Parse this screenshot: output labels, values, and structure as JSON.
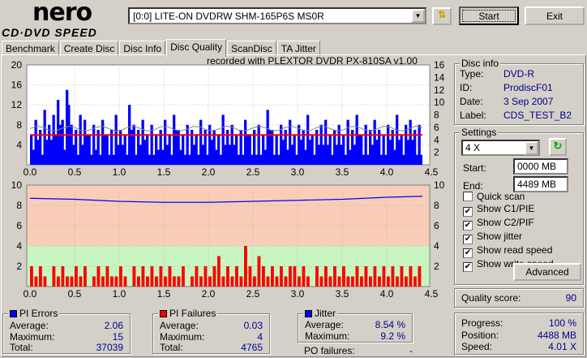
{
  "logo": {
    "line1": "nero",
    "line2": "CD·DVD SPEED"
  },
  "drive": {
    "selected": "[0:0]  LITE-ON DVDRW SHM-165P6S MS0R"
  },
  "buttons": {
    "start": "Start",
    "exit": "Exit",
    "advanced": "Advanced"
  },
  "tabs": [
    {
      "label": "Benchmark"
    },
    {
      "label": "Create Disc"
    },
    {
      "label": "Disc Info"
    },
    {
      "label": "Disc Quality",
      "active": true
    },
    {
      "label": "ScanDisc"
    },
    {
      "label": "TA Jitter"
    }
  ],
  "recorded": "recorded with PLEXTOR DVDR   PX-810SA  v1.00",
  "disc_info": {
    "title": "Disc info",
    "type_label": "Type:",
    "type": "DVD-R",
    "id_label": "ID:",
    "id": "ProdiscF01",
    "date_label": "Date:",
    "date": "3 Sep 2007",
    "label_label": "Label:",
    "label": "CDS_TEST_B2"
  },
  "settings": {
    "title": "Settings",
    "speed": "4 X",
    "start_label": "Start:",
    "start": "0000 MB",
    "end_label": "End:",
    "end": "4489 MB",
    "checks": [
      {
        "label": "Quick scan",
        "checked": false
      },
      {
        "label": "Show C1/PIE",
        "checked": true
      },
      {
        "label": "Show C2/PIF",
        "checked": true
      },
      {
        "label": "Show jitter",
        "checked": true
      },
      {
        "label": "Show read speed",
        "checked": true
      },
      {
        "label": "Show write speed",
        "checked": true
      }
    ]
  },
  "quality": {
    "label": "Quality score:",
    "value": "90"
  },
  "progress": {
    "progress_label": "Progress:",
    "progress": "100 %",
    "position_label": "Position:",
    "position": "4488 MB",
    "speed_label": "Speed:",
    "speed": "4.01 X"
  },
  "pi_errors": {
    "title": "PI Errors",
    "color": "#0000ff",
    "avg_label": "Average:",
    "avg": "2.06",
    "max_label": "Maximum:",
    "max": "15",
    "total_label": "Total:",
    "total": "37039"
  },
  "pi_failures": {
    "title": "PI Failures",
    "color": "#ff0000",
    "avg_label": "Average:",
    "avg": "0.03",
    "max_label": "Maximum:",
    "max": "4",
    "total_label": "Total:",
    "total": "4765"
  },
  "jitter": {
    "title": "Jitter",
    "color": "#0000ff",
    "avg_label": "Average:",
    "avg": "8.54 %",
    "max_label": "Maximum:",
    "max": "9.2 %",
    "po_label": "PO failures:",
    "po": "-"
  },
  "chart_data": [
    {
      "type": "bar",
      "title": "PI Errors",
      "x_ticks": [
        "0.0",
        "0.5",
        "1.0",
        "1.5",
        "2.0",
        "2.5",
        "3.0",
        "3.5",
        "4.0",
        "4.5"
      ],
      "xlim": [
        0,
        4.5
      ],
      "y_left_ticks": [
        "4",
        "8",
        "12",
        "16",
        "20"
      ],
      "ylim_left": [
        0,
        20
      ],
      "y_right_ticks": [
        "2",
        "4",
        "6",
        "8",
        "10",
        "12",
        "14",
        "16"
      ],
      "ylim_right": [
        0,
        16
      ],
      "pie_max": 15,
      "read_speed_x": 4.0,
      "write_speed_approx": 5.8,
      "pie_samples": [
        6,
        9,
        7,
        11,
        8,
        10,
        13,
        9,
        15,
        8,
        7,
        10,
        9,
        6,
        8,
        7,
        9,
        6,
        7,
        10,
        7,
        6,
        12,
        8,
        7,
        9,
        6,
        8,
        6,
        7,
        9,
        6,
        10,
        7,
        6,
        8,
        7,
        6,
        9,
        7,
        8,
        7,
        6,
        10,
        7,
        8,
        6,
        7,
        9,
        6,
        7,
        8,
        6,
        11,
        7,
        6,
        8,
        7,
        9,
        6,
        8,
        7,
        10,
        6,
        7,
        8,
        9,
        6,
        7,
        8,
        6,
        9,
        7,
        10,
        6,
        8,
        7,
        9,
        7,
        6,
        8,
        7,
        10,
        6,
        8,
        9,
        7,
        8
      ]
    },
    {
      "type": "bar+line",
      "title": "PI Failures / Jitter",
      "x_ticks": [
        "0.0",
        "0.5",
        "1.0",
        "1.5",
        "2.0",
        "2.5",
        "3.0",
        "3.5",
        "4.0",
        "4.5"
      ],
      "xlim": [
        0,
        4.5
      ],
      "y_left_ticks": [
        "2",
        "4",
        "6",
        "8",
        "10"
      ],
      "ylim_left": [
        0,
        10
      ],
      "y_right_ticks": [
        "2",
        "4",
        "6",
        "8",
        "10"
      ],
      "ylim_right": [
        0,
        10
      ],
      "pif_samples": [
        2,
        1,
        2,
        1,
        0,
        2,
        1,
        2,
        1,
        1,
        2,
        1,
        2,
        0,
        1,
        2,
        1,
        2,
        1,
        1,
        2,
        1,
        0,
        2,
        1,
        2,
        1,
        2,
        1,
        2,
        1,
        2,
        1,
        1,
        2,
        0,
        1,
        2,
        1,
        2,
        1,
        2,
        3,
        1,
        2,
        1,
        2,
        1,
        4,
        2,
        1,
        3,
        2,
        1,
        2,
        1,
        2,
        1,
        2,
        2,
        1,
        2,
        1,
        0,
        2,
        1,
        2,
        1,
        2,
        1,
        2,
        1,
        1,
        2,
        1,
        2,
        1,
        2,
        1,
        2,
        1,
        2,
        1,
        2,
        1,
        2,
        1,
        2
      ],
      "jitter_x": [
        0,
        0.5,
        1.0,
        1.5,
        2.0,
        2.5,
        3.0,
        3.5,
        4.0,
        4.4
      ],
      "jitter": [
        8.7,
        8.6,
        8.4,
        8.3,
        8.3,
        8.4,
        8.5,
        8.6,
        8.8,
        8.9
      ]
    }
  ]
}
